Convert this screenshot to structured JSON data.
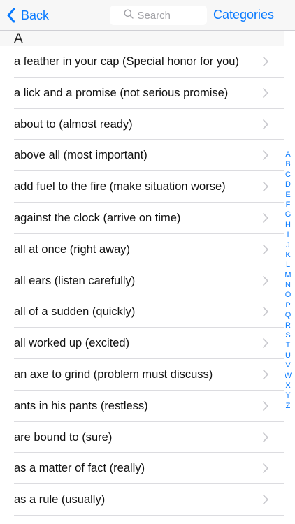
{
  "nav": {
    "back_label": "Back",
    "search_placeholder": "Search",
    "categories_label": "Categories"
  },
  "section": {
    "letter": "A"
  },
  "items": [
    "a feather in your cap (Special honor for you)",
    "a lick and a promise (not serious promise)",
    "about to (almost ready)",
    "above all (most important)",
    "add fuel to the fire (make situation worse)",
    "against the clock (arrive on time)",
    "all at once (right away)",
    "all ears (listen carefully)",
    "all of a sudden (quickly)",
    "all worked up (excited)",
    "an axe to grind (problem must discuss)",
    "ants in his pants (restless)",
    "are bound to (sure)",
    "as a matter of fact (really)",
    "as a rule (usually)"
  ],
  "index_letters": [
    "A",
    "B",
    "C",
    "D",
    "E",
    "F",
    "G",
    "H",
    "I",
    "J",
    "K",
    "L",
    "M",
    "N",
    "O",
    "P",
    "Q",
    "R",
    "S",
    "T",
    "U",
    "V",
    "W",
    "X",
    "Y",
    "Z"
  ],
  "colors": {
    "accent": "#0a7bff",
    "navbar_bg": "#f7f7f7",
    "chevron": "#c7c7cc"
  },
  "icons": {
    "back": "chevron-left-icon",
    "search": "search-icon",
    "row": "chevron-right-icon"
  }
}
